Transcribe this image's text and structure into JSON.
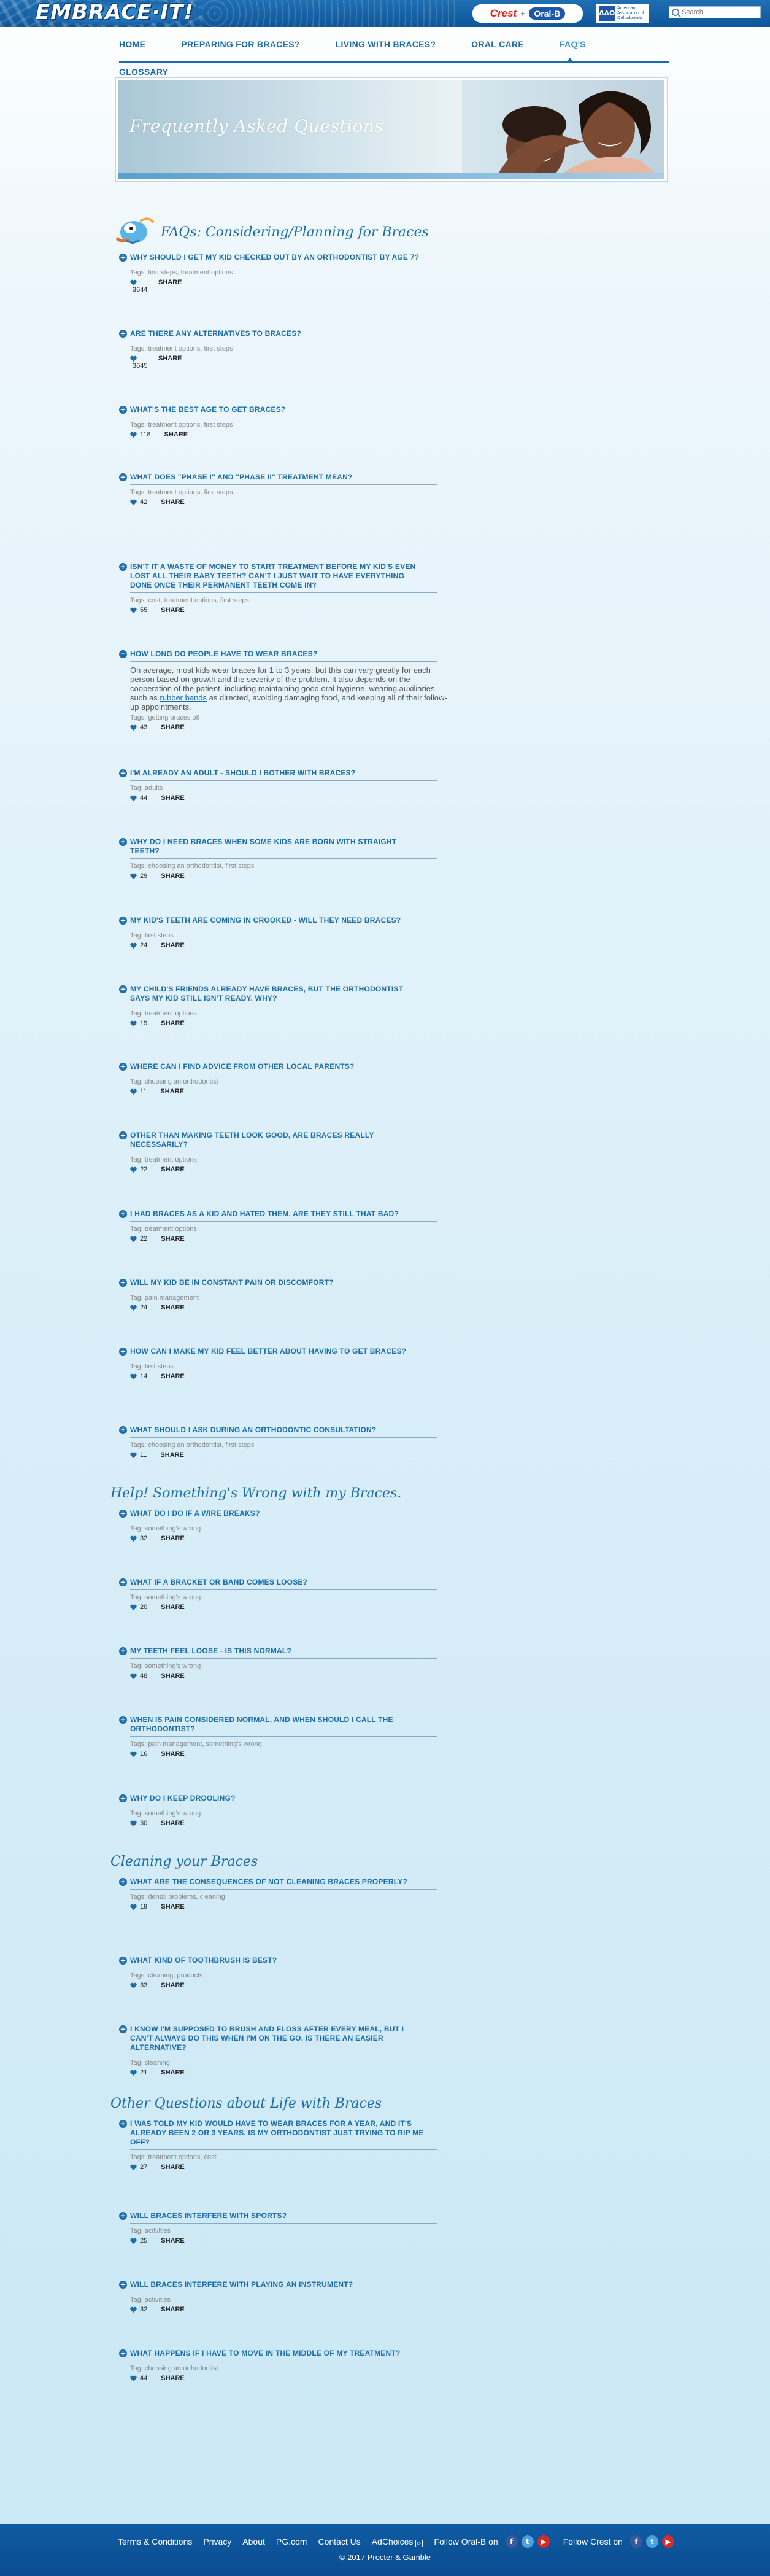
{
  "header": {
    "logo": "EMBRACE·IT!",
    "brand_crest": "Crest",
    "brand_plus": "+",
    "brand_oralb": "Oral-B",
    "aao_mark": "AAO",
    "aao_text": "American Association of Orthodontists",
    "search_placeholder": "Search"
  },
  "nav": {
    "items": [
      "HOME",
      "PREPARING FOR BRACES?",
      "LIVING WITH BRACES?",
      "ORAL CARE",
      "FAQ'S"
    ],
    "glossary": "GLOSSARY"
  },
  "hero": {
    "title": "Frequently Asked Questions"
  },
  "colors": {
    "accent": "#1b6ca8",
    "footer": "#0f5ba3",
    "tag_gray": "#8a8a8a"
  },
  "sections": [
    {
      "title": "FAQs: Considering/Planning for Braces"
    },
    {
      "title": "Help! Something's Wrong with my Braces."
    },
    {
      "title": "Cleaning your Braces"
    },
    {
      "title": "Other Questions about Life with Braces"
    }
  ],
  "share_label": "SHARE",
  "questions": [
    {
      "q": "Why should I get my kid checked out by an orthodontist by age 7?",
      "tags": "Tags: first steps, treatment options",
      "count": "3644"
    },
    {
      "q": "Are there any alternatives to braces?",
      "tags": "Tags: treatment options, first steps",
      "count": "3645"
    },
    {
      "q": "What's the best age to get braces?",
      "tags": "Tags: treatment options, first steps",
      "count": "118"
    },
    {
      "q": "What does \"Phase I\" and \"Phase II\" treatment mean?",
      "tags": "Tags: treatment options, first steps",
      "count": "42"
    },
    {
      "q": "Isn't it a waste of money to start treatment before my kid's even lost all their baby teeth? Can't I just wait to have everything done once their permanent teeth come in?",
      "tags": "Tags: cost, treatment options, first steps",
      "count": "55"
    },
    {
      "q": "How long do people have to wear braces?",
      "answer_a": "On average, most kids wear braces for 1 to 3 years, but this can vary greatly for each person based on growth and the severity of the problem. It also depends on the cooperation of the patient, including maintaining good oral hygiene, wearing auxiliaries such as ",
      "answer_link": "rubber bands",
      "answer_b": " as directed, avoiding damaging food, and keeping all of their follow-up appointments.",
      "tags": "Tags: getting braces off",
      "count": "43"
    },
    {
      "q": "I'm already an adult - should I bother with braces?",
      "tags": "Tag: adults",
      "count": "44"
    },
    {
      "q": "Why do I need braces when some kids are born with straight teeth?",
      "tags": "Tags: choosing an orthodontist, first steps",
      "count": "29"
    },
    {
      "q": "My kid's teeth are coming in crooked - will they need braces?",
      "tags": "Tag: first steps",
      "count": "24"
    },
    {
      "q": "My child's friends already have braces, but the orthodontist says my kid still isn't ready. Why?",
      "tags": "Tag: treatment options",
      "count": "19"
    },
    {
      "q": "Where can I find advice from other local parents?",
      "tags": "Tag: choosing an orthodontist",
      "count": "11"
    },
    {
      "q": "Other than making teeth look good, are braces really necessarily?",
      "tags": "Tag: treatment options",
      "count": "22"
    },
    {
      "q": "I had braces as a kid and hated them. Are they still that bad?",
      "tags": "Tag: treatment options",
      "count": "22"
    },
    {
      "q": "Will my kid be in constant pain or discomfort?",
      "tags": "Tag: pain management",
      "count": "24"
    },
    {
      "q": "How can I make my kid feel better about having to get braces?",
      "tags": "Tag: first steps",
      "count": "14"
    },
    {
      "q": "What should I ask during an orthodontic consultation?",
      "tags": "Tags: choosing an orthodontist, first steps",
      "count": "11"
    },
    {
      "q": "What do I do if a wire breaks?",
      "tags": "Tag: something's wrong",
      "count": "32"
    },
    {
      "q": "What if a bracket or band comes loose?",
      "tags": "Tag: something's wrong",
      "count": "20"
    },
    {
      "q": "My teeth feel loose - is this normal?",
      "tags": "Tag: something's wrong",
      "count": "48"
    },
    {
      "q": "When is pain considered normal, and when should I call the orthodontist?",
      "tags": "Tags: pain management, something's wrong",
      "count": "16"
    },
    {
      "q": "Why do I keep drooling?",
      "tags": "Tag: something's wrong",
      "count": "30"
    },
    {
      "q": "What are the consequences of not cleaning braces properly?",
      "tags": "Tags: dental problems, cleaning",
      "count": "19"
    },
    {
      "q": "What kind of toothbrush is best?",
      "tags": "Tags: cleaning, products",
      "count": "33"
    },
    {
      "q": "I know I'm supposed to brush and floss after every meal, but I can't always do this when I'm on the go. Is there an easier alternative?",
      "tags": "Tag: cleaning",
      "count": "21"
    },
    {
      "q": "I was told my kid would have to wear braces for a year, and it's already been 2 or 3 years. Is my orthodontist just trying to rip me off?",
      "tags": "Tags: treatment options, cost",
      "count": "27"
    },
    {
      "q": "Will braces interfere with sports?",
      "tags": "Tag: activities",
      "count": "25"
    },
    {
      "q": "Will braces interfere with playing an instrument?",
      "tags": "Tag: activities",
      "count": "32"
    },
    {
      "q": "What happens if I have to move in the middle of my treatment?",
      "tags": "Tag: choosing an orthodontist",
      "count": "44"
    }
  ],
  "footer": {
    "links": [
      "Terms & Conditions",
      "Privacy",
      "About",
      "PG.com",
      "Contact Us",
      "AdChoices"
    ],
    "follow_oralb": "Follow Oral-B on",
    "follow_crest": "Follow Crest on",
    "copyright": "© 2017 Procter & Gamble"
  }
}
